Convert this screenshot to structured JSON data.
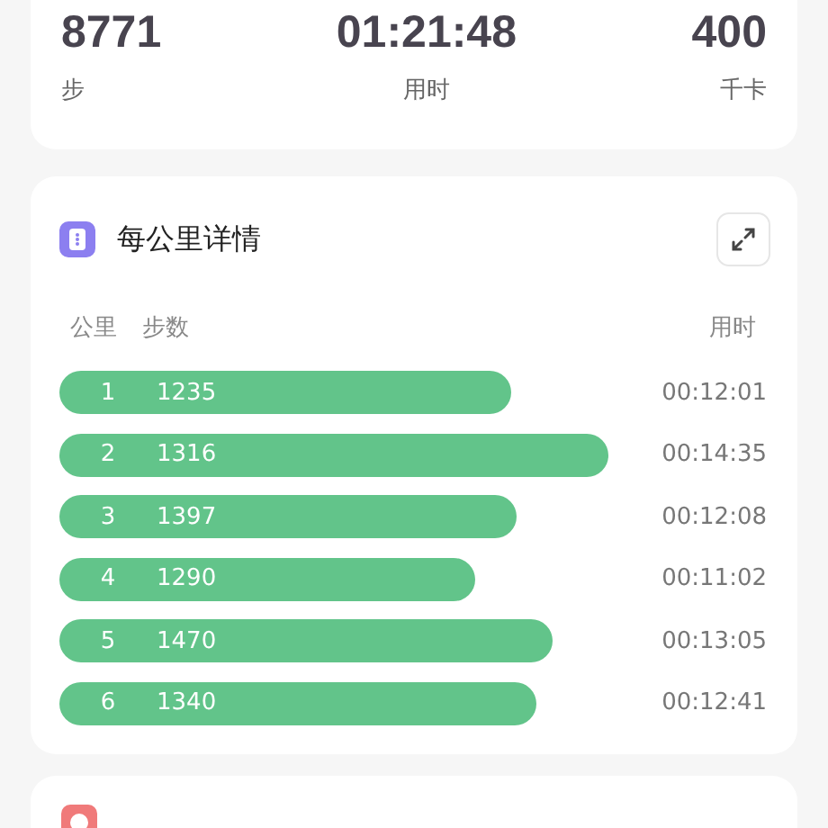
{
  "summary": [
    {
      "value": "8771",
      "label": "步"
    },
    {
      "value": "01:21:48",
      "label": "用时"
    },
    {
      "value": "400",
      "label": "千卡"
    }
  ],
  "km_detail": {
    "title": "每公里详情",
    "columns": [
      "公里",
      "步数",
      "用时"
    ],
    "rows": [
      {
        "km": "1",
        "steps": "1235",
        "time": "00:12:01"
      },
      {
        "km": "2",
        "steps": "1316",
        "time": "00:14:35"
      },
      {
        "km": "3",
        "steps": "1397",
        "time": "00:12:08"
      },
      {
        "km": "4",
        "steps": "1290",
        "time": "00:11:02"
      },
      {
        "km": "5",
        "steps": "1470",
        "time": "00:13:05"
      },
      {
        "km": "6",
        "steps": "1340",
        "time": "00:12:41"
      }
    ]
  }
}
